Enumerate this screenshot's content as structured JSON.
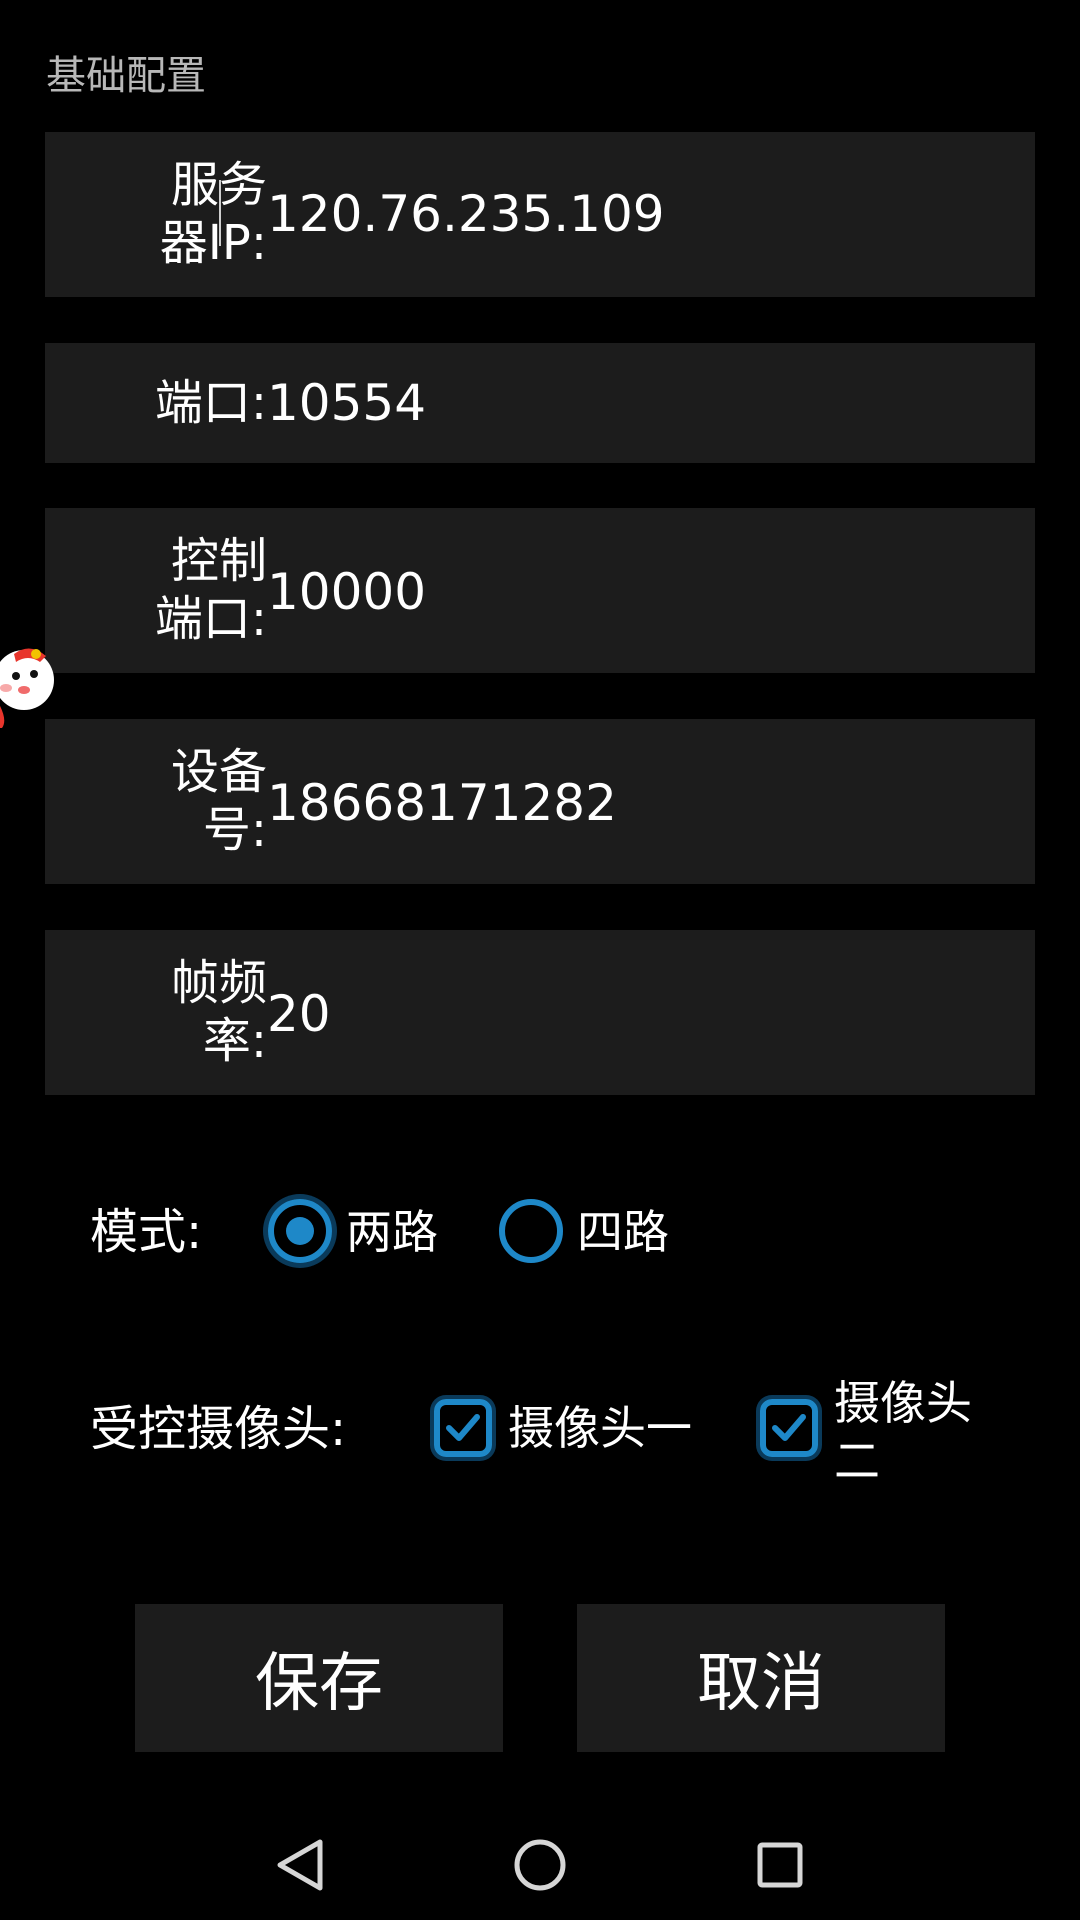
{
  "section": {
    "title": "基础配置"
  },
  "fields": {
    "server_ip": {
      "label": "服务器IP:",
      "value": "120.76.235.109"
    },
    "port": {
      "label": "端口:",
      "value": "10554"
    },
    "control_port": {
      "label": "控制端口:",
      "value": "10000"
    },
    "device_no": {
      "label": "设备号:",
      "value": "18668171282"
    },
    "frame_rate": {
      "label": "帧频率:",
      "value": "20"
    }
  },
  "mode": {
    "label": "模式:",
    "options": [
      {
        "label": "两路",
        "selected": true
      },
      {
        "label": "四路",
        "selected": false
      }
    ]
  },
  "cameras": {
    "label": "受控摄像头:",
    "options": [
      {
        "label": "摄像头一",
        "checked": true
      },
      {
        "label": "摄像头二",
        "checked": true
      }
    ]
  },
  "buttons": {
    "save": "保存",
    "cancel": "取消"
  },
  "colors": {
    "accent": "#1e88c8",
    "field_bg": "#1c1c1c",
    "background": "#000000"
  },
  "icons": {
    "nav_back": "back-triangle-icon",
    "nav_home": "home-circle-icon",
    "nav_recents": "recents-square-icon",
    "floating": "mascot-icon"
  }
}
